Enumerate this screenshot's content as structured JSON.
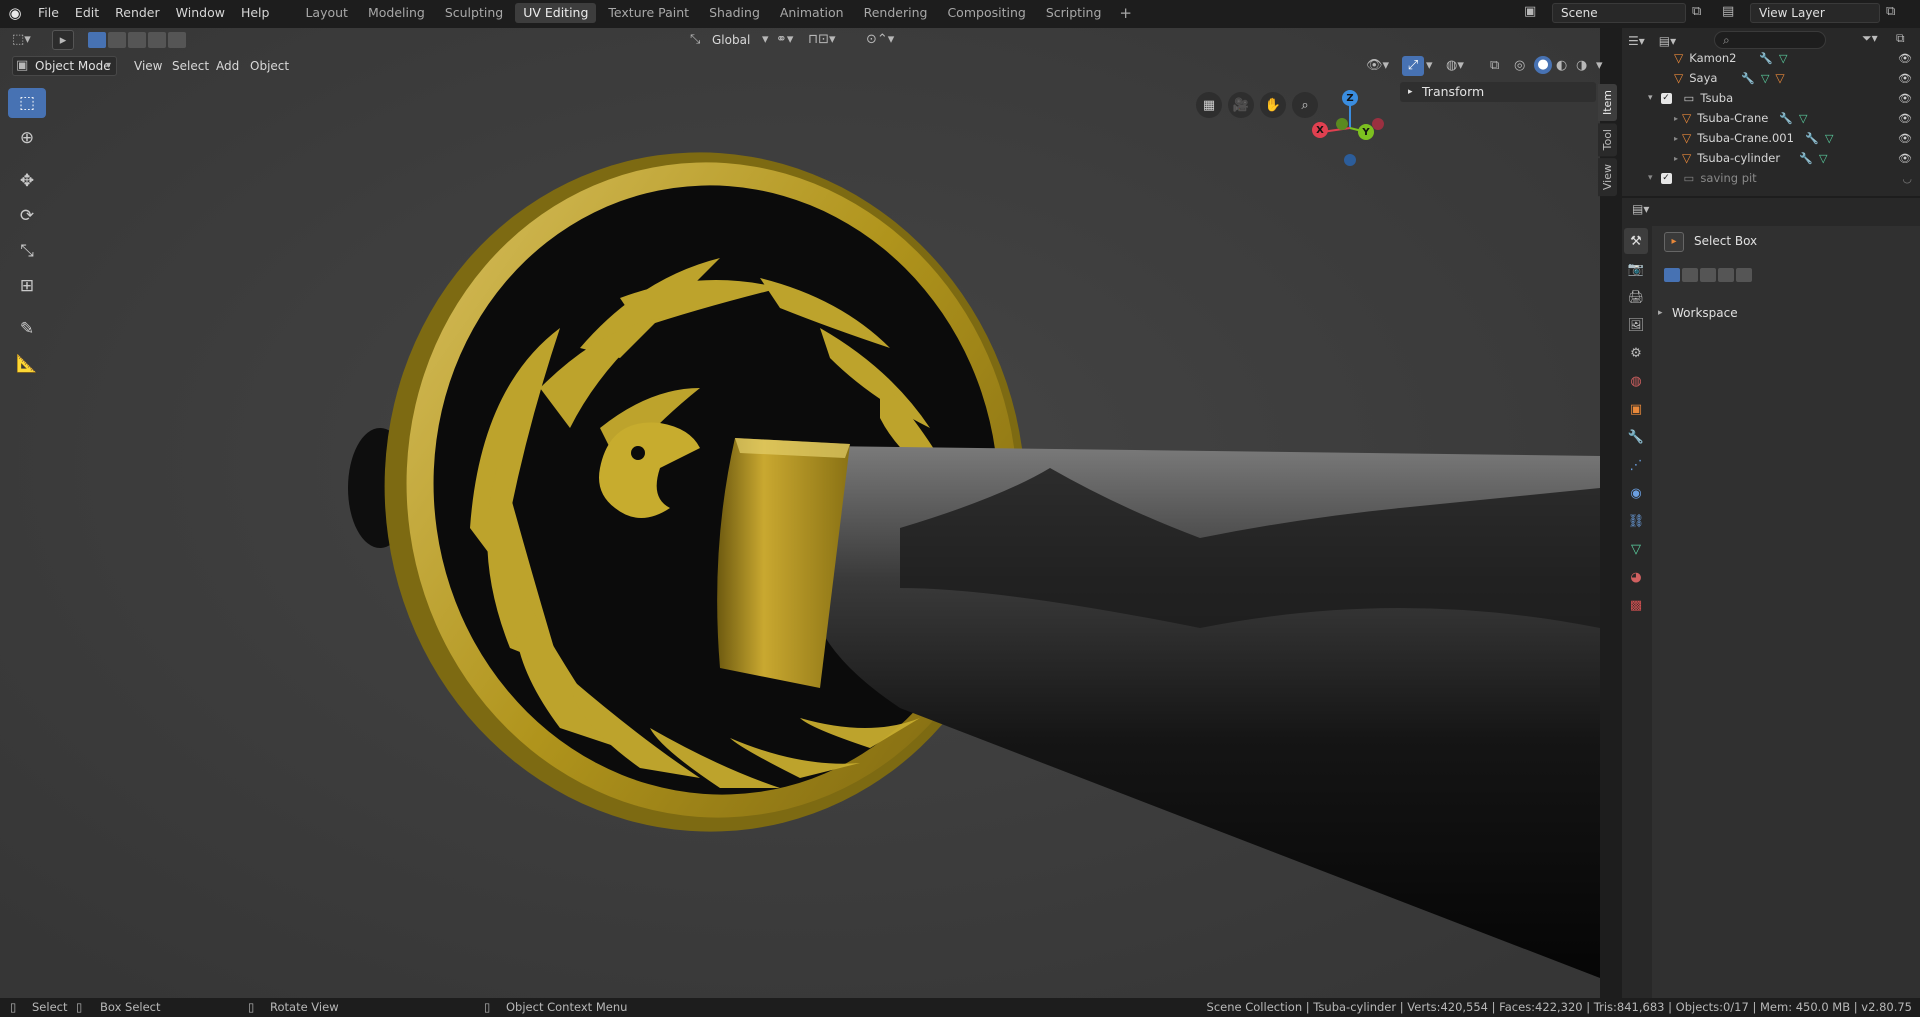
{
  "menu": {
    "file": "File",
    "edit": "Edit",
    "render": "Render",
    "window": "Window",
    "help": "Help"
  },
  "workspaces": [
    "Layout",
    "Modeling",
    "Sculpting",
    "UV Editing",
    "Texture Paint",
    "Shading",
    "Animation",
    "Rendering",
    "Compositing",
    "Scripting"
  ],
  "active_workspace": "UV Editing",
  "scene": "Scene",
  "view_layer": "View Layer",
  "viewport": {
    "mode": "Object Mode",
    "menus": [
      "View",
      "Select",
      "Add",
      "Object"
    ],
    "orientation": "Global",
    "transform_panel": "Transform",
    "side_tabs": [
      "Item",
      "Tool",
      "View"
    ],
    "gizmo": {
      "x": "X",
      "y": "Y",
      "z": "Z"
    }
  },
  "outliner": {
    "rows": [
      {
        "name": "Kamon2"
      },
      {
        "name": "Saya"
      },
      {
        "name": "Tsuba"
      },
      {
        "name": "Tsuba-Crane"
      },
      {
        "name": "Tsuba-Crane.001"
      },
      {
        "name": "Tsuba-cylinder"
      },
      {
        "name": "saving pit"
      }
    ]
  },
  "properties": {
    "tool_name": "Select Box",
    "workspace_label": "Workspace"
  },
  "status": {
    "select": "Select",
    "box_select": "Box Select",
    "rotate_view": "Rotate View",
    "context_menu": "Object Context Menu",
    "info": "Scene Collection | Tsuba-cylinder | Verts:420,554 | Faces:422,320 | Tris:841,683 | Objects:0/17 | Mem: 450.0 MB | v2.80.75"
  },
  "colors": {
    "accent": "#4772b3",
    "mesh_orange": "#e8883a",
    "gold": "#b89a1e"
  }
}
